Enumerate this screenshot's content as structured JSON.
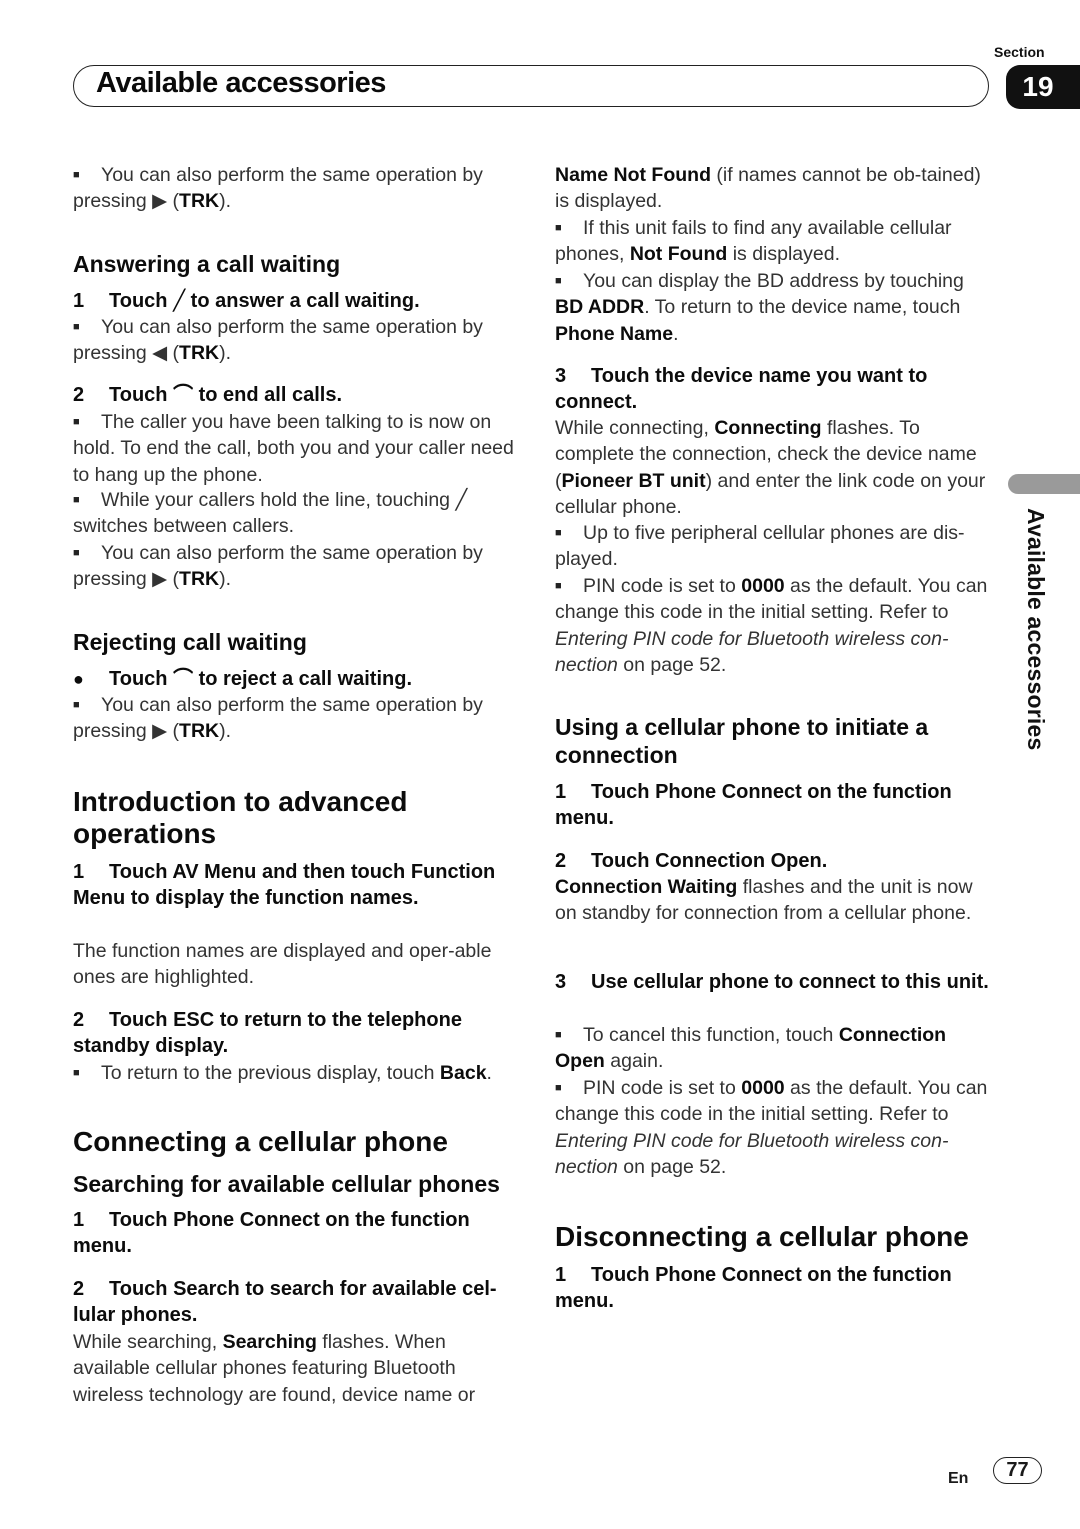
{
  "header": {
    "section_label": "Section",
    "section_number": "19",
    "title": "Available accessories"
  },
  "side_tab": {
    "label": "Available accessories"
  },
  "footer": {
    "language": "En",
    "page_number": "77"
  },
  "left_column": [
    {
      "type": "bullet",
      "runs": [
        {
          "t": "You can also perform the same operation by pressing "
        },
        {
          "t": "▶",
          "g": 1
        },
        {
          "t": " ("
        },
        {
          "t": "TRK",
          "b": 1
        },
        {
          "t": ")."
        }
      ]
    },
    {
      "type": "h2",
      "text": "Answering a call waiting"
    },
    {
      "type": "step",
      "num": "1",
      "runs": [
        {
          "t": "Touch "
        },
        {
          "t": "╱",
          "g": 1
        },
        {
          "t": " to answer a call waiting."
        }
      ]
    },
    {
      "type": "bullet",
      "runs": [
        {
          "t": "You can also perform the same operation by pressing "
        },
        {
          "t": "◀",
          "g": 1
        },
        {
          "t": " ("
        },
        {
          "t": "TRK",
          "b": 1
        },
        {
          "t": ")."
        }
      ]
    },
    {
      "type": "step",
      "num": "2",
      "runs": [
        {
          "t": "Touch "
        },
        {
          "t": "⌒",
          "g": 1
        },
        {
          "t": " to end all calls."
        }
      ]
    },
    {
      "type": "bullet",
      "runs": [
        {
          "t": "The caller you have been talking to is now on hold. To end the call, both you and your caller need to hang up the phone."
        }
      ]
    },
    {
      "type": "bullet",
      "runs": [
        {
          "t": "While your callers hold the line, touching "
        },
        {
          "t": "╱",
          "g": 1
        },
        {
          "t": " switches between callers."
        }
      ]
    },
    {
      "type": "bullet",
      "runs": [
        {
          "t": "You can also perform the same operation by pressing "
        },
        {
          "t": "▶",
          "g": 1
        },
        {
          "t": " ("
        },
        {
          "t": "TRK",
          "b": 1
        },
        {
          "t": ")."
        }
      ]
    },
    {
      "type": "h2",
      "text": "Rejecting call waiting"
    },
    {
      "type": "dotstep",
      "runs": [
        {
          "t": "Touch "
        },
        {
          "t": "⌒",
          "g": 1
        },
        {
          "t": " to reject a call waiting."
        }
      ]
    },
    {
      "type": "bullet",
      "runs": [
        {
          "t": "You can also perform the same operation by pressing "
        },
        {
          "t": "▶",
          "g": 1
        },
        {
          "t": " ("
        },
        {
          "t": "TRK",
          "b": 1
        },
        {
          "t": ")."
        }
      ]
    },
    {
      "type": "h1",
      "text": "Introduction to advanced operations"
    },
    {
      "type": "step",
      "num": "1",
      "runs": [
        {
          "t": "Touch AV Menu and then touch Function Menu to display the function names."
        }
      ]
    },
    {
      "type": "para",
      "runs": [
        {
          "t": "The function names are displayed and oper-able ones are highlighted."
        }
      ]
    },
    {
      "type": "step",
      "num": "2",
      "runs": [
        {
          "t": "Touch ESC to return to the telephone standby display."
        }
      ]
    },
    {
      "type": "bullet",
      "runs": [
        {
          "t": "To return to the previous display, touch "
        },
        {
          "t": "Back",
          "b": 1
        },
        {
          "t": "."
        }
      ]
    },
    {
      "type": "h1",
      "text": "Connecting a cellular phone"
    },
    {
      "type": "h2",
      "text": "Searching for available cellular phones"
    },
    {
      "type": "step",
      "num": "1",
      "runs": [
        {
          "t": "Touch Phone Connect on the function menu."
        }
      ]
    },
    {
      "type": "step",
      "num": "2",
      "runs": [
        {
          "t": "Touch Search to search for available cel-lular phones."
        }
      ]
    },
    {
      "type": "para",
      "runs": [
        {
          "t": "While searching, "
        },
        {
          "t": "Searching",
          "b": 1
        },
        {
          "t": " flashes. When available cellular phones featuring Bluetooth wireless technology are found, device name or"
        }
      ]
    }
  ],
  "right_column": [
    {
      "type": "para",
      "runs": [
        {
          "t": "Name Not Found",
          "b": 1
        },
        {
          "t": " (if names cannot be ob-tained) is displayed."
        }
      ]
    },
    {
      "type": "bullet",
      "runs": [
        {
          "t": "If this unit fails to find any available cellular phones, "
        },
        {
          "t": "Not Found",
          "b": 1
        },
        {
          "t": " is displayed."
        }
      ]
    },
    {
      "type": "bullet",
      "runs": [
        {
          "t": "You can display the BD address by touching "
        },
        {
          "t": "BD ADDR",
          "b": 1
        },
        {
          "t": ". To return to the device name, touch "
        },
        {
          "t": "Phone Name",
          "b": 1
        },
        {
          "t": "."
        }
      ]
    },
    {
      "type": "step",
      "num": "3",
      "runs": [
        {
          "t": "Touch the device name you want to connect."
        }
      ]
    },
    {
      "type": "para",
      "runs": [
        {
          "t": "While connecting, "
        },
        {
          "t": "Connecting",
          "b": 1
        },
        {
          "t": " flashes. To complete the connection, check the device name ("
        },
        {
          "t": "Pioneer BT unit",
          "b": 1
        },
        {
          "t": ") and enter the link code on your cellular phone."
        }
      ]
    },
    {
      "type": "bullet",
      "runs": [
        {
          "t": "Up to five peripheral cellular phones are dis-played."
        }
      ]
    },
    {
      "type": "bullet",
      "runs": [
        {
          "t": "PIN code is set to "
        },
        {
          "t": "0000",
          "b": 1
        },
        {
          "t": " as the default. You can change this code in the initial setting. Refer to "
        },
        {
          "t": "Entering PIN code for Bluetooth wireless con-nection",
          "i": 1
        },
        {
          "t": " on page 52."
        }
      ]
    },
    {
      "type": "h2",
      "text": "Using a cellular phone to initiate a connection"
    },
    {
      "type": "step",
      "num": "1",
      "runs": [
        {
          "t": "Touch Phone Connect on the function menu."
        }
      ]
    },
    {
      "type": "step",
      "num": "2",
      "runs": [
        {
          "t": "Touch Connection Open."
        }
      ]
    },
    {
      "type": "para",
      "runs": [
        {
          "t": "Connection Waiting",
          "b": 1
        },
        {
          "t": " flashes and the unit is now on standby for connection from a cellular phone."
        }
      ]
    },
    {
      "type": "step",
      "num": "3",
      "runs": [
        {
          "t": "Use cellular phone to connect to this unit."
        }
      ]
    },
    {
      "type": "bullet",
      "runs": [
        {
          "t": "To cancel this function, touch "
        },
        {
          "t": "Connection Open",
          "b": 1
        },
        {
          "t": " again."
        }
      ]
    },
    {
      "type": "bullet",
      "runs": [
        {
          "t": "PIN code is set to "
        },
        {
          "t": "0000",
          "b": 1
        },
        {
          "t": " as the default. You can change this code in the initial setting. Refer to "
        },
        {
          "t": "Entering PIN code for Bluetooth wireless con-nection",
          "i": 1
        },
        {
          "t": " on page 52."
        }
      ]
    },
    {
      "type": "h1",
      "text": "Disconnecting a cellular phone"
    },
    {
      "type": "step",
      "num": "1",
      "runs": [
        {
          "t": "Touch Phone Connect on the function menu."
        }
      ]
    }
  ]
}
